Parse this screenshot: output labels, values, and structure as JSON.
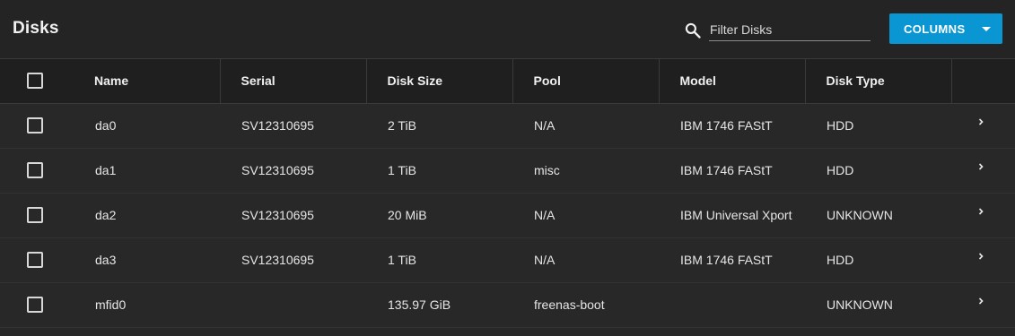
{
  "header": {
    "title": "Disks",
    "search_placeholder": "Filter Disks",
    "columns_button": "COLUMNS"
  },
  "table": {
    "columns": [
      "Name",
      "Serial",
      "Disk Size",
      "Pool",
      "Model",
      "Disk Type"
    ],
    "rows": [
      {
        "name": "da0",
        "serial": "SV12310695",
        "size": "2 TiB",
        "pool": "N/A",
        "model": "IBM 1746 FAStT",
        "type": "HDD"
      },
      {
        "name": "da1",
        "serial": "SV12310695",
        "size": "1 TiB",
        "pool": "misc",
        "model": "IBM 1746 FAStT",
        "type": "HDD"
      },
      {
        "name": "da2",
        "serial": "SV12310695",
        "size": "20 MiB",
        "pool": "N/A",
        "model": "IBM Universal Xport",
        "type": "UNKNOWN"
      },
      {
        "name": "da3",
        "serial": "SV12310695",
        "size": "1 TiB",
        "pool": "N/A",
        "model": "IBM 1746 FAStT",
        "type": "HDD"
      },
      {
        "name": "mfid0",
        "serial": "",
        "size": "135.97 GiB",
        "pool": "freenas-boot",
        "model": "",
        "type": "UNKNOWN"
      }
    ]
  },
  "colors": {
    "accent": "#0a95d3",
    "background": "#282828",
    "header_background": "#1f1f1f"
  },
  "icons": {
    "search": "search-icon",
    "dropdown": "caret-down-icon",
    "row_expand": "chevron-right-icon",
    "select": "checkbox-icon"
  }
}
